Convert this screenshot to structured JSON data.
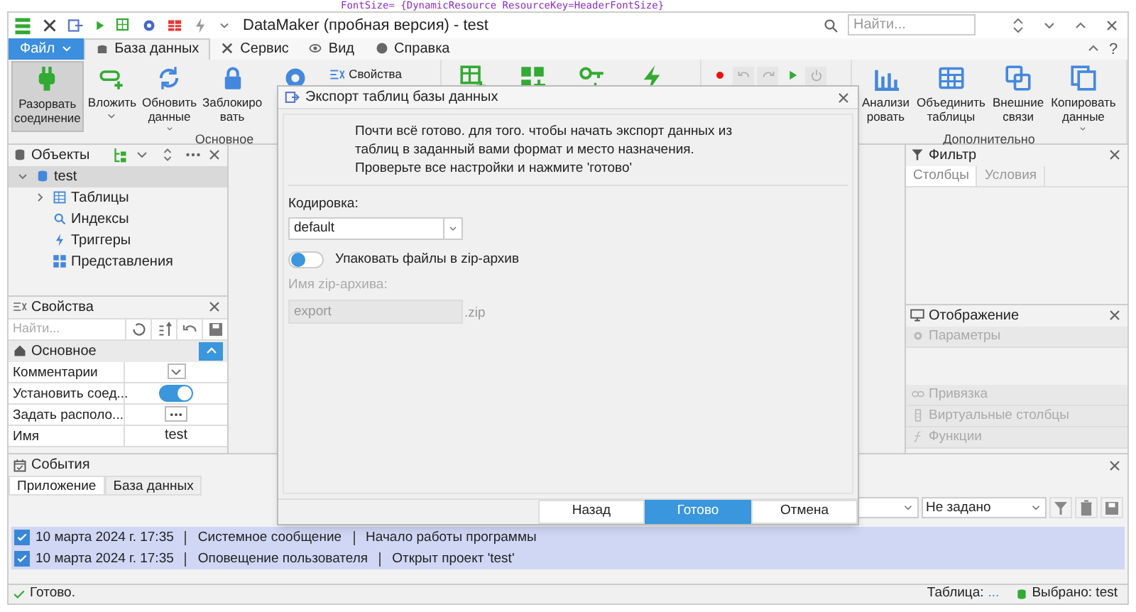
{
  "background_code": "FontSize= {DynamicResource ResourceKey=HeaderFontSize}",
  "window": {
    "title": "DataMaker (пробная версия) - test",
    "search": {
      "placeholder": "Найти..."
    }
  },
  "menu": [
    {
      "label": "Файл",
      "kind": "file",
      "selected": false
    },
    {
      "label": "База данных",
      "kind": "tab",
      "selected": true
    },
    {
      "label": "Сервис",
      "kind": "tab",
      "selected": false
    },
    {
      "label": "Вид",
      "kind": "tab",
      "selected": false
    },
    {
      "label": "Справка",
      "kind": "tab",
      "selected": false
    }
  ],
  "help": "?",
  "ribbon": [
    {
      "label": "Основное",
      "buttons": [
        {
          "kind": "large",
          "lines": [
            "Разорвать",
            "соединение"
          ],
          "active": true,
          "caret": false
        },
        {
          "kind": "large",
          "lines": [
            "Вложить"
          ],
          "active": false,
          "caret": true
        },
        {
          "kind": "large",
          "lines": [
            "Обновить",
            "данные"
          ],
          "active": false,
          "caret": true
        },
        {
          "kind": "large",
          "lines": [
            "Заблокиро",
            "вать"
          ],
          "active": false,
          "caret": false
        },
        {
          "kind": "icon"
        },
        {
          "kind": "small",
          "lines": [
            "Свойства"
          ]
        }
      ]
    },
    {
      "buttons": [
        {
          "kind": "icon"
        },
        {
          "kind": "icon"
        },
        {
          "kind": "icon"
        },
        {
          "kind": "icon"
        }
      ]
    },
    {
      "buttons": [
        {
          "kind": "tiny",
          "disabled": false
        },
        {
          "kind": "tiny",
          "disabled": true
        },
        {
          "kind": "tiny",
          "disabled": true
        },
        {
          "kind": "tiny",
          "disabled": false
        },
        {
          "kind": "tiny",
          "disabled": true
        }
      ]
    },
    {
      "label": "Дополнительно",
      "buttons": [
        {
          "kind": "large",
          "lines": [
            "Анализи",
            "ровать"
          ],
          "active": false,
          "caret": false
        },
        {
          "kind": "large",
          "lines": [
            "Объединить",
            "таблицы"
          ],
          "active": false,
          "caret": false
        },
        {
          "kind": "large",
          "lines": [
            "Внешние",
            "связи"
          ],
          "active": false,
          "caret": false
        },
        {
          "kind": "large",
          "lines": [
            "Копировать",
            "данные"
          ],
          "active": false,
          "caret": true
        }
      ]
    }
  ],
  "objects_panel": {
    "title": "Объекты",
    "tree": [
      {
        "label": "test",
        "expanded": true,
        "selected": true,
        "children": [
          {
            "label": "Таблицы",
            "expanded": false,
            "selected": false
          },
          {
            "label": "Индексы",
            "selected": false
          },
          {
            "label": "Триггеры",
            "selected": false
          },
          {
            "label": "Представления",
            "selected": false
          }
        ]
      }
    ]
  },
  "properties_panel": {
    "title": "Свойства",
    "search": {
      "placeholder": "Найти..."
    },
    "section": "Основное",
    "rows": [
      {
        "name": "Комментарии",
        "kind": "dropdown"
      },
      {
        "name": "Установить соед...",
        "kind": "toggle",
        "on": true
      },
      {
        "name": "Задать располо...",
        "kind": "ellipsis"
      },
      {
        "name": "Имя",
        "kind": "text",
        "value": "test"
      }
    ]
  },
  "filter_panel": {
    "title": "Фильтр",
    "tabs": [
      {
        "label": "Столбцы",
        "selected": true
      },
      {
        "label": "Условия",
        "selected": false
      }
    ]
  },
  "display_panel": {
    "title": "Отображение",
    "sections": [
      {
        "label": "Параметры",
        "disabled": true
      },
      {
        "label": "Привязка",
        "disabled": true
      },
      {
        "label": "Виртуальные столбцы",
        "disabled": true
      },
      {
        "label": "Функции",
        "disabled": true
      }
    ]
  },
  "events_panel": {
    "title": "События",
    "tabs": [
      {
        "label": "Приложение",
        "selected": true
      },
      {
        "label": "База данных",
        "selected": false
      }
    ],
    "filter_value": "Не задано",
    "rows": [
      {
        "checked": true,
        "date": "10 марта 2024 г. 17:35",
        "type": "Системное сообщение",
        "message": "Начало работы программы"
      },
      {
        "checked": true,
        "date": "10 марта 2024 г. 17:35",
        "type": "Оповещение пользователя",
        "message": "Открыт проект 'test'"
      }
    ]
  },
  "status_bar": {
    "status": "Готово.",
    "table_label": "Таблица:",
    "table_value": "...",
    "selected": "Выбрано: test"
  },
  "dialog": {
    "title": "Экспорт таблиц базы данных",
    "intro": "Почти всё готово. для того. чтобы начать экспорт данных из таблиц в заданный вами формат и место назначения. Проверьте все настройки и нажмите 'готово'",
    "encoding_label": "Кодировка:",
    "encoding_value": "default",
    "zip_toggle": {
      "label": "Упаковать файлы в zip-архив",
      "on": false
    },
    "zip_name_label": "Имя zip-архива:",
    "zip_name_value": "export",
    "zip_suffix": ".zip",
    "buttons": [
      {
        "label": "Назад",
        "primary": false
      },
      {
        "label": "Готово",
        "primary": true
      },
      {
        "label": "Отмена",
        "primary": false
      }
    ]
  }
}
